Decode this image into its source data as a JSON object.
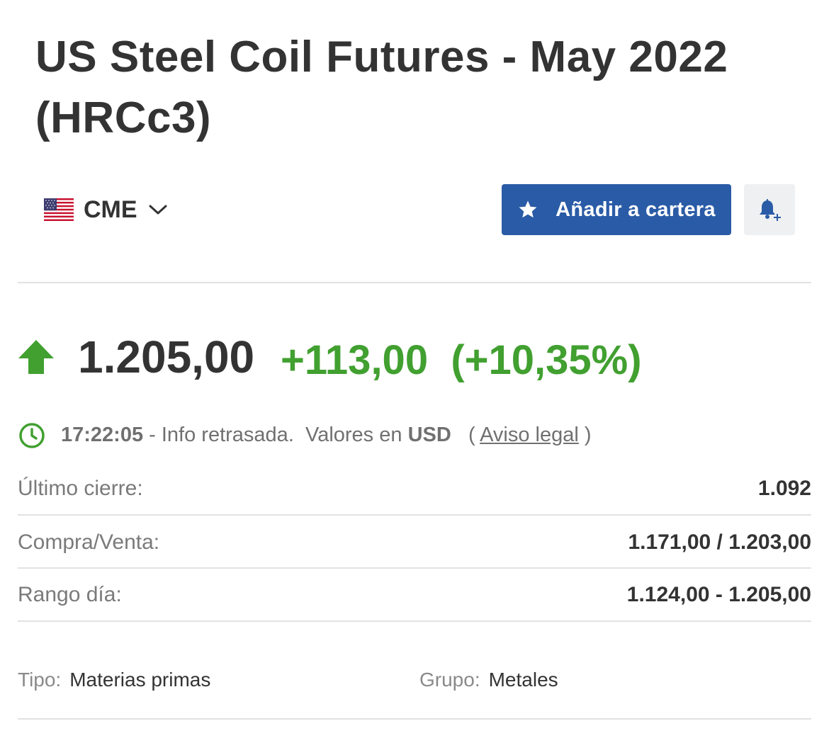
{
  "header": {
    "title": "US Steel Coil Futures - May 2022 (HRCc3)"
  },
  "exchange": {
    "label": "CME",
    "flag_icon": "us-flag-icon"
  },
  "actions": {
    "add_to_portfolio_label": "Añadir a cartera",
    "alert_icon": "bell-plus-icon"
  },
  "quote": {
    "price": "1.205,00",
    "change": "+113,00",
    "change_pct": "(+10,35%)",
    "direction": "up"
  },
  "info": {
    "time": "17:22:05",
    "delay_text": "- Info retrasada.",
    "values_in": "Valores en",
    "currency": "USD",
    "legal_open": "(",
    "legal_link": "Aviso legal",
    "legal_close": ")"
  },
  "stats": [
    {
      "label": "Último cierre:",
      "value": "1.092"
    },
    {
      "label": "Compra/Venta:",
      "value": "1.171,00 / 1.203,00"
    },
    {
      "label": "Rango día:",
      "value": "1.124,00 - 1.205,00"
    }
  ],
  "meta": {
    "type_label": "Tipo:",
    "type_value": "Materias primas",
    "group_label": "Grupo:",
    "group_value": "Metales"
  },
  "colors": {
    "accent_blue": "#2a5ba6",
    "positive_green": "#41a030",
    "text_dark": "#333333",
    "text_muted": "#7a7a7a",
    "divider": "#e2e2e2"
  }
}
